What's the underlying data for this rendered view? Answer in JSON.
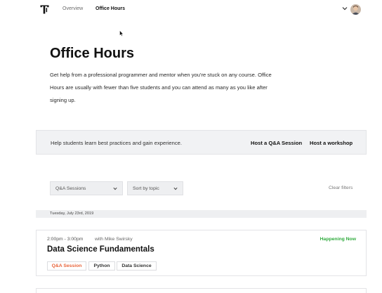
{
  "nav": {
    "logo_icon": "t-logo-icon",
    "links": [
      {
        "label": "Overview",
        "active": false
      },
      {
        "label": "Office Hours",
        "active": true
      }
    ],
    "account_menu_icon": "chevron-down-icon",
    "avatar_icon": "user-avatar"
  },
  "hero": {
    "title": "Office Hours",
    "intro_lines": [
      "Get help from a professional programmer and mentor when you're stuck on any course. Office",
      "Hours are usually with fewer than five students and you can attend as many as you like after",
      "signing up."
    ]
  },
  "banner": {
    "text": "Help students learn best practices and gain experience.",
    "host_qa_label": "Host a Q&A Session",
    "host_workshop_label": "Host a workshop"
  },
  "filters": {
    "type_select": "Q&A Sessions",
    "sort_select": "Sort by topic",
    "clear_label": "Clear filters"
  },
  "date_header": "Tuesday, July 23rd, 2019",
  "session": {
    "time": "2:00pm - 3:00pm",
    "mentor": "with Mike Swirsky",
    "status": "Happening Now",
    "title": "Data Science Fundamentals",
    "tags": [
      "Q&A Session",
      "Python",
      "Data Science"
    ]
  },
  "colors": {
    "accent_orange": "#e8643a",
    "status_green": "#2eaa3c",
    "panel_gray": "#f1f2f4"
  }
}
